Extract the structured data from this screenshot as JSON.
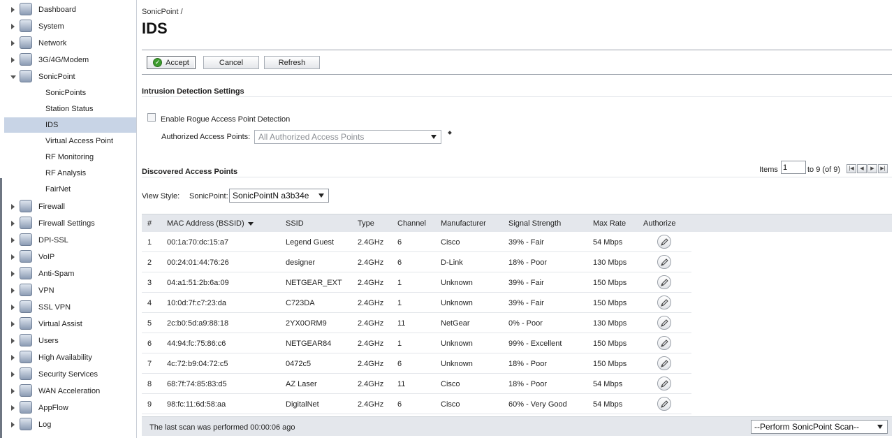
{
  "sidebar": {
    "items": [
      {
        "label": "Dashboard",
        "icon": "dashboard-icon"
      },
      {
        "label": "System",
        "icon": "system-icon"
      },
      {
        "label": "Network",
        "icon": "network-icon"
      },
      {
        "label": "3G/4G/Modem",
        "icon": "modem-icon"
      },
      {
        "label": "SonicPoint",
        "icon": "sonicpoint-icon",
        "expanded": true
      },
      {
        "label": "Firewall",
        "icon": "firewall-icon"
      },
      {
        "label": "Firewall Settings",
        "icon": "firewall-settings-icon"
      },
      {
        "label": "DPI-SSL",
        "icon": "dpi-ssl-icon"
      },
      {
        "label": "VoIP",
        "icon": "voip-icon"
      },
      {
        "label": "Anti-Spam",
        "icon": "anti-spam-icon"
      },
      {
        "label": "VPN",
        "icon": "vpn-icon"
      },
      {
        "label": "SSL VPN",
        "icon": "ssl-vpn-icon"
      },
      {
        "label": "Virtual Assist",
        "icon": "virtual-assist-icon"
      },
      {
        "label": "Users",
        "icon": "users-icon"
      },
      {
        "label": "High Availability",
        "icon": "high-availability-icon"
      },
      {
        "label": "Security Services",
        "icon": "security-services-icon"
      },
      {
        "label": "WAN Acceleration",
        "icon": "wan-acceleration-icon"
      },
      {
        "label": "AppFlow",
        "icon": "appflow-icon"
      },
      {
        "label": "Log",
        "icon": "log-icon"
      }
    ],
    "subitems": [
      {
        "label": "SonicPoints"
      },
      {
        "label": "Station Status"
      },
      {
        "label": "IDS",
        "active": true
      },
      {
        "label": "Virtual Access Point"
      },
      {
        "label": "RF Monitoring"
      },
      {
        "label": "RF Analysis"
      },
      {
        "label": "FairNet"
      }
    ]
  },
  "header": {
    "breadcrumb": "SonicPoint /",
    "title": "IDS"
  },
  "toolbar": {
    "accept_label": "Accept",
    "cancel_label": "Cancel",
    "refresh_label": "Refresh"
  },
  "ids_settings": {
    "section_title": "Intrusion Detection Settings",
    "rogue_label": "Enable Rogue Access Point Detection",
    "rogue_checked": false,
    "auth_label": "Authorized Access Points:",
    "auth_value": "All Authorized Access Points"
  },
  "discovered": {
    "section_title": "Discovered Access Points",
    "items_label": "Items",
    "page_value": "1",
    "range_label": "to 9 (of 9)",
    "view_style_label": "View Style:",
    "sonicpoint_label": "SonicPoint:",
    "sonicpoint_value": "SonicPointN a3b34e",
    "columns": [
      "#",
      "MAC Address (BSSID)",
      "SSID",
      "Type",
      "Channel",
      "Manufacturer",
      "Signal Strength",
      "Max Rate",
      "Authorize"
    ],
    "rows": [
      [
        "1",
        "00:1a:70:dc:15:a7",
        "Legend Guest",
        "2.4GHz",
        "6",
        "Cisco",
        "39% - Fair",
        "54 Mbps"
      ],
      [
        "2",
        "00:24:01:44:76:26",
        "designer",
        "2.4GHz",
        "6",
        "D-Link",
        "18% - Poor",
        "130 Mbps"
      ],
      [
        "3",
        "04:a1:51:2b:6a:09",
        "NETGEAR_EXT",
        "2.4GHz",
        "1",
        "Unknown",
        "39% - Fair",
        "150 Mbps"
      ],
      [
        "4",
        "10:0d:7f:c7:23:da",
        "C723DA",
        "2.4GHz",
        "1",
        "Unknown",
        "39% - Fair",
        "150 Mbps"
      ],
      [
        "5",
        "2c:b0:5d:a9:88:18",
        "2YX0ORM9",
        "2.4GHz",
        "11",
        "NetGear",
        "0% - Poor",
        "130 Mbps"
      ],
      [
        "6",
        "44:94:fc:75:86:c6",
        "NETGEAR84",
        "2.4GHz",
        "1",
        "Unknown",
        "99% - Excellent",
        "150 Mbps"
      ],
      [
        "7",
        "4c:72:b9:04:72:c5",
        "0472c5",
        "2.4GHz",
        "6",
        "Unknown",
        "18% - Poor",
        "150 Mbps"
      ],
      [
        "8",
        "68:7f:74:85:83:d5",
        "AZ Laser",
        "2.4GHz",
        "11",
        "Cisco",
        "18% - Poor",
        "54 Mbps"
      ],
      [
        "9",
        "98:fc:11:6d:58:aa",
        "DigitalNet",
        "2.4GHz",
        "6",
        "Cisco",
        "60% - Very Good",
        "54 Mbps"
      ]
    ]
  },
  "footer": {
    "last_scan": "The last scan was performed 00:00:06 ago",
    "scan_action": "--Perform SonicPoint Scan--"
  },
  "colors": {
    "active_nav": "#c8d4e6",
    "header_bg": "#e4e7ec",
    "accept_icon": "#3d9c2e"
  }
}
